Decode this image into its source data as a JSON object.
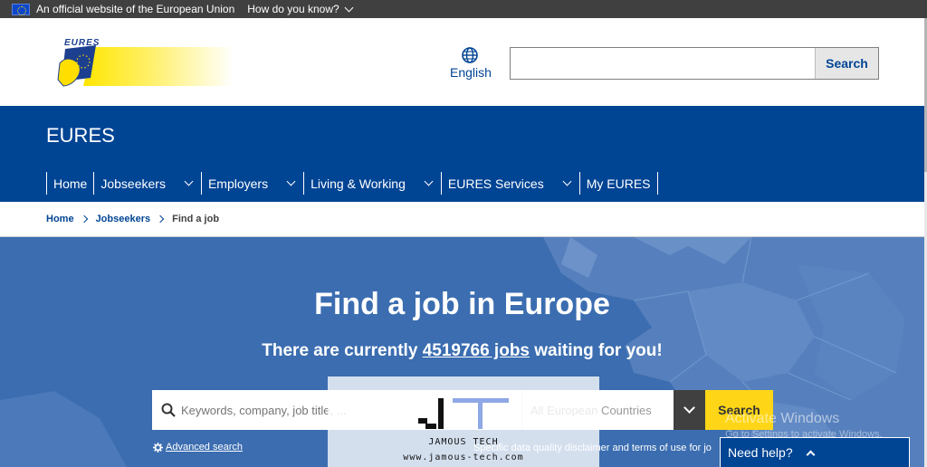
{
  "eu_bar": {
    "official_text": "An official website of the European Union",
    "know_text": "How do you know?"
  },
  "header": {
    "logo_text": "EURES",
    "language": "English",
    "search_placeholder": "",
    "search_button": "Search"
  },
  "site": {
    "title": "EURES",
    "nav": [
      {
        "label": "Home"
      },
      {
        "label": "Jobseekers"
      },
      {
        "label": "Employers"
      },
      {
        "label": "Living & Working"
      },
      {
        "label": "EURES Services"
      },
      {
        "label": "My EURES"
      }
    ]
  },
  "breadcrumb": [
    "Home",
    "Jobseekers",
    "Find a job"
  ],
  "hero": {
    "title": "Find a job in Europe",
    "sub_before": "There are currently ",
    "job_count_link": "4519766 jobs",
    "sub_after": " waiting for you!",
    "keywords_placeholder": "Keywords, company, job title, ...",
    "country_placeholder": "All European Countries",
    "search_button": "Search",
    "advanced_search": "Advanced search",
    "disclaimer": "Specific data quality disclaimer and terms of use for jo"
  },
  "watermark": {
    "name": "JAMOUS TECH",
    "url": "www.jamous-tech.com"
  },
  "os_overlay": {
    "activate_title": "Activate Windows",
    "activate_sub": "Go to Settings to activate Windows."
  },
  "help": {
    "label": "Need help?"
  },
  "colors": {
    "eu_bar": "#404040",
    "primary_blue": "#004494",
    "hero_blue": "#3b6db0",
    "accent_yellow": "#ffd617"
  }
}
